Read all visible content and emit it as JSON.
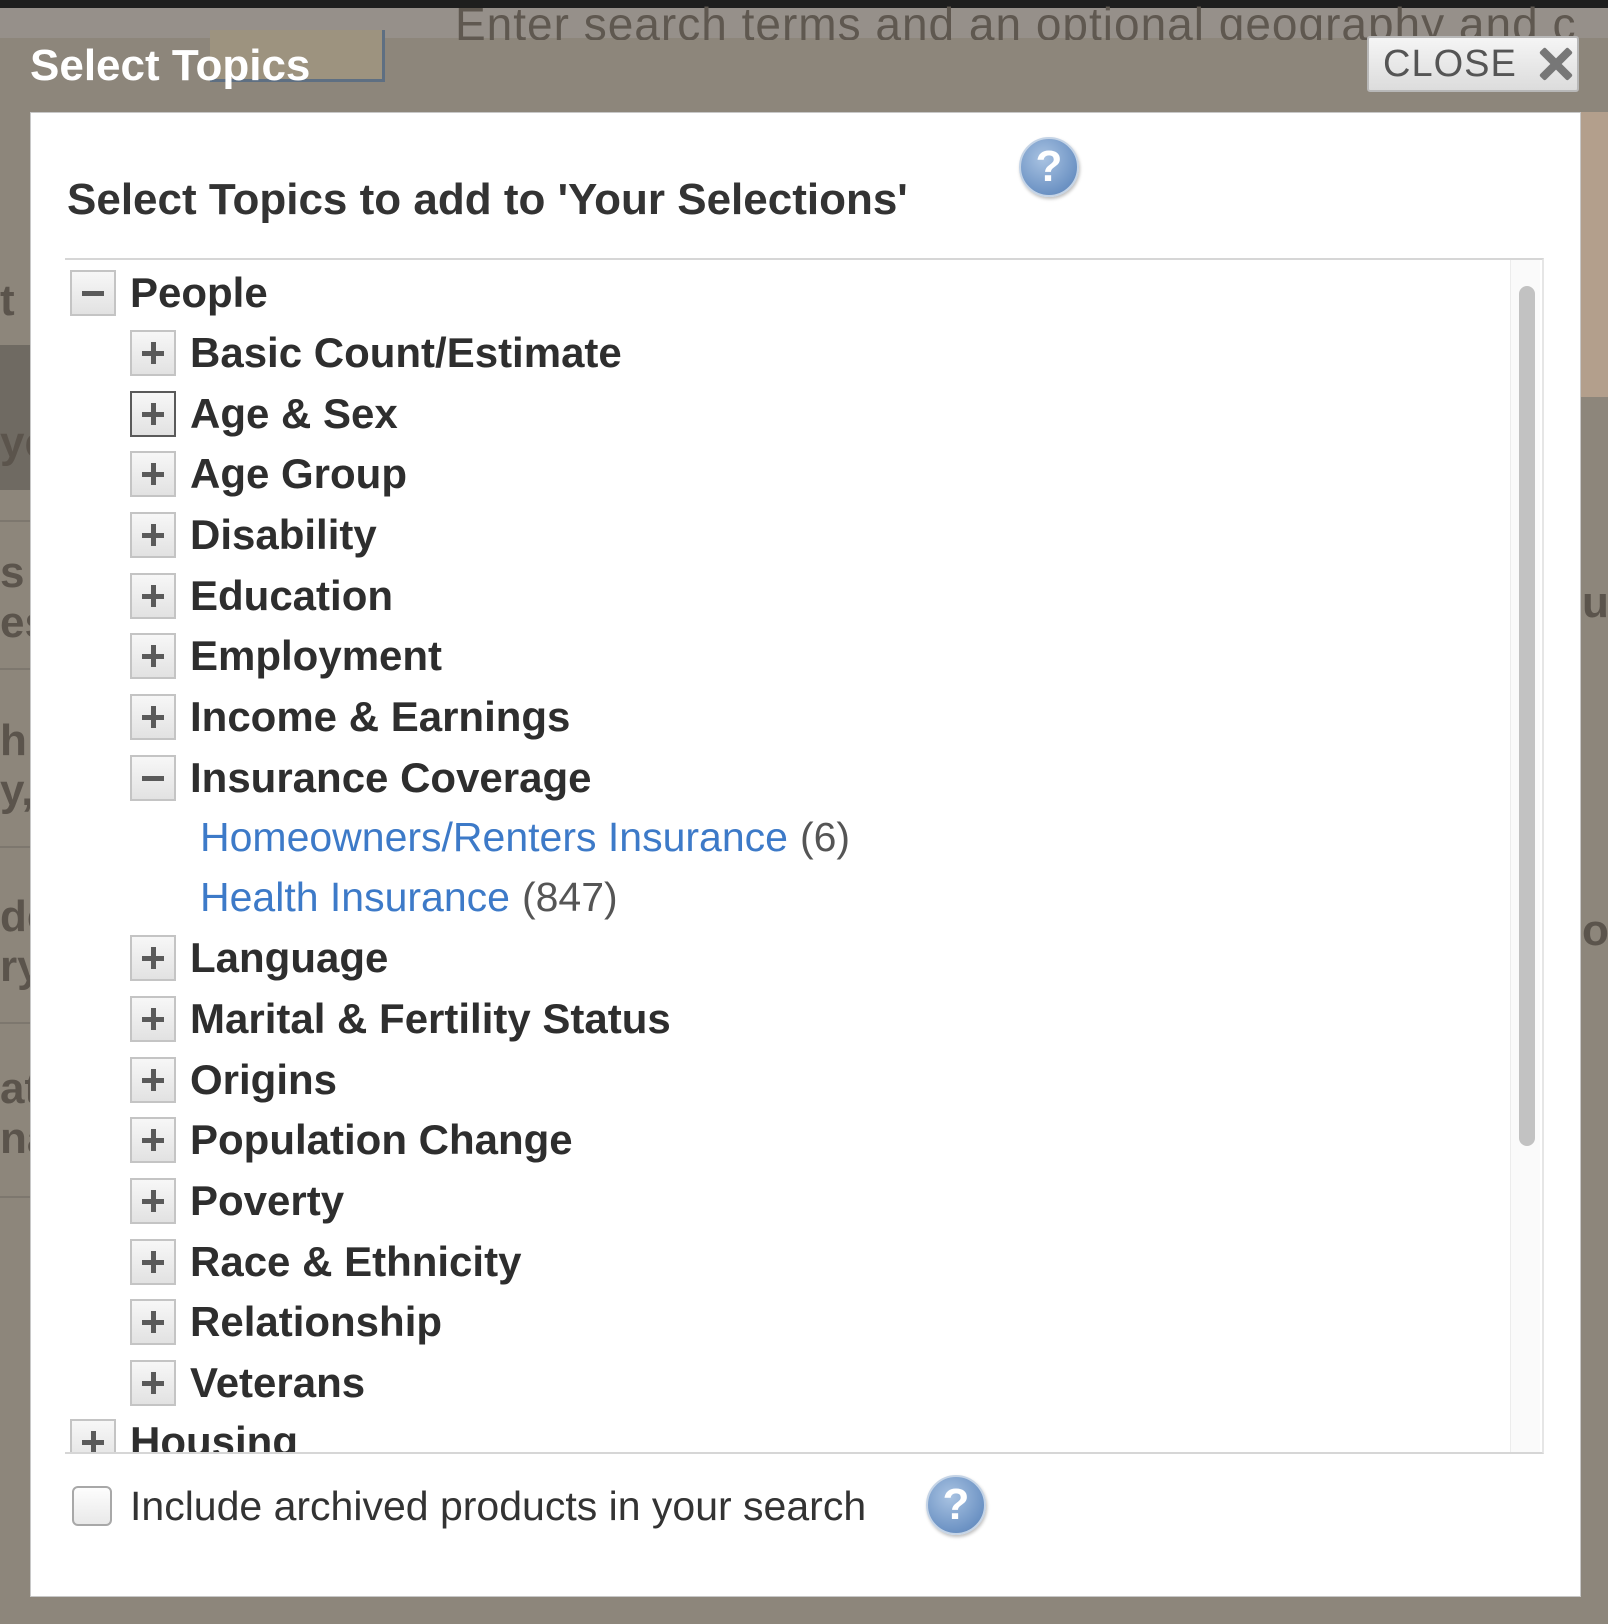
{
  "background": {
    "search_hint": "Enter search terms and an optional geography and c",
    "left_fragments": [
      "t",
      "ye",
      "s",
      "es",
      "h",
      "y,",
      "de",
      "ry",
      "at",
      "na"
    ],
    "right_fragments": [
      "us",
      "o"
    ]
  },
  "modal": {
    "title": "Select Topics",
    "close_label": "CLOSE",
    "heading": "Select Topics to add to 'Your Selections'",
    "help_symbol": "?",
    "archive_label": "Include archived products in your search"
  },
  "tree": {
    "root": {
      "label": "People",
      "state": "expanded"
    },
    "items": [
      {
        "label": "Basic Count/Estimate",
        "state": "collapsed"
      },
      {
        "label": "Age & Sex",
        "state": "collapsed"
      },
      {
        "label": "Age Group",
        "state": "collapsed"
      },
      {
        "label": "Disability",
        "state": "collapsed"
      },
      {
        "label": "Education",
        "state": "collapsed"
      },
      {
        "label": "Employment",
        "state": "collapsed"
      },
      {
        "label": "Income & Earnings",
        "state": "collapsed"
      },
      {
        "label": "Insurance Coverage",
        "state": "expanded"
      },
      {
        "label": "Language",
        "state": "collapsed"
      },
      {
        "label": "Marital & Fertility Status",
        "state": "collapsed"
      },
      {
        "label": "Origins",
        "state": "collapsed"
      },
      {
        "label": "Population Change",
        "state": "collapsed"
      },
      {
        "label": "Poverty",
        "state": "collapsed"
      },
      {
        "label": "Race & Ethnicity",
        "state": "collapsed"
      },
      {
        "label": "Relationship",
        "state": "collapsed"
      },
      {
        "label": "Veterans",
        "state": "collapsed"
      }
    ],
    "insurance_children": [
      {
        "label": "Homeowners/Renters Insurance",
        "count": "(6)"
      },
      {
        "label": "Health Insurance",
        "count": "(847)"
      }
    ],
    "next_root": {
      "label": "Housing",
      "state": "collapsed"
    }
  },
  "colors": {
    "link": "#3d7ac8",
    "overlay": "#8d877d",
    "help_icon": "#6d93c4"
  }
}
